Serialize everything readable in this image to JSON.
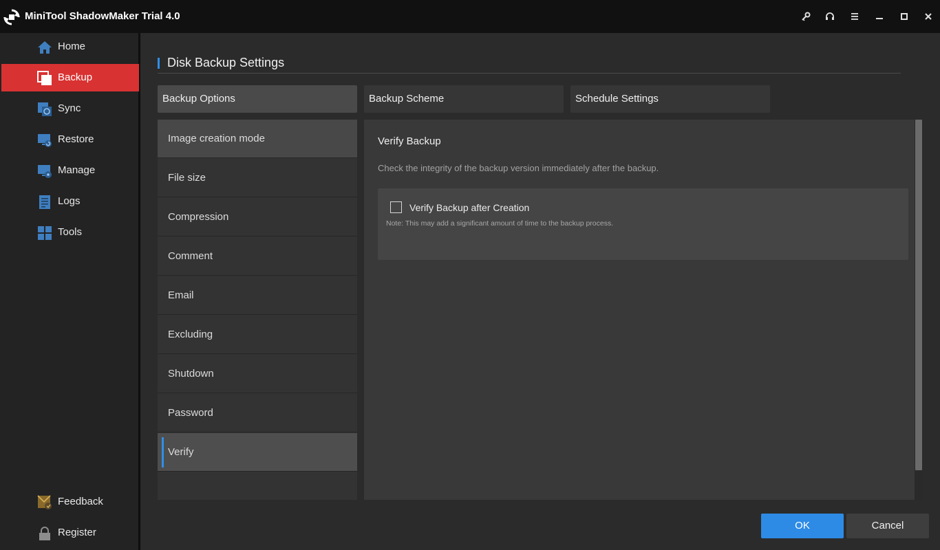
{
  "window": {
    "title": "MiniTool ShadowMaker Trial 4.0",
    "logo_icon": "minitool-logo",
    "controls": [
      "key-icon",
      "headset-icon",
      "menu-icon",
      "minimize-icon",
      "maximize-icon",
      "close-icon"
    ]
  },
  "sidebar": {
    "items": [
      {
        "label": "Home",
        "icon": "home-icon"
      },
      {
        "label": "Backup",
        "icon": "backup-icon",
        "active": true
      },
      {
        "label": "Sync",
        "icon": "sync-icon"
      },
      {
        "label": "Restore",
        "icon": "restore-icon"
      },
      {
        "label": "Manage",
        "icon": "manage-icon"
      },
      {
        "label": "Logs",
        "icon": "logs-icon"
      },
      {
        "label": "Tools",
        "icon": "tools-icon"
      }
    ],
    "bottom": [
      {
        "label": "Feedback",
        "icon": "feedback-icon"
      },
      {
        "label": "Register",
        "icon": "lock-icon"
      }
    ]
  },
  "main": {
    "title": "Disk Backup Settings",
    "tabs": [
      {
        "label": "Backup Options",
        "active": true
      },
      {
        "label": "Backup Scheme"
      },
      {
        "label": "Schedule Settings"
      }
    ],
    "options": [
      {
        "label": "Image creation mode"
      },
      {
        "label": "File size"
      },
      {
        "label": "Compression"
      },
      {
        "label": "Comment"
      },
      {
        "label": "Email"
      },
      {
        "label": "Excluding"
      },
      {
        "label": "Shutdown"
      },
      {
        "label": "Password"
      },
      {
        "label": "Verify",
        "selected": true
      }
    ],
    "detail": {
      "title": "Verify Backup",
      "description": "Check the integrity of the backup version immediately after the backup.",
      "checkbox_label": "Verify Backup after Creation",
      "checkbox_checked": false,
      "note": "Note: This may add a significant amount of time to the backup process."
    },
    "buttons": {
      "ok": "OK",
      "cancel": "Cancel"
    }
  },
  "colors": {
    "accent_blue": "#2f8fe8",
    "active_red": "#d93232",
    "icon_blue": "#3f7fc0"
  }
}
